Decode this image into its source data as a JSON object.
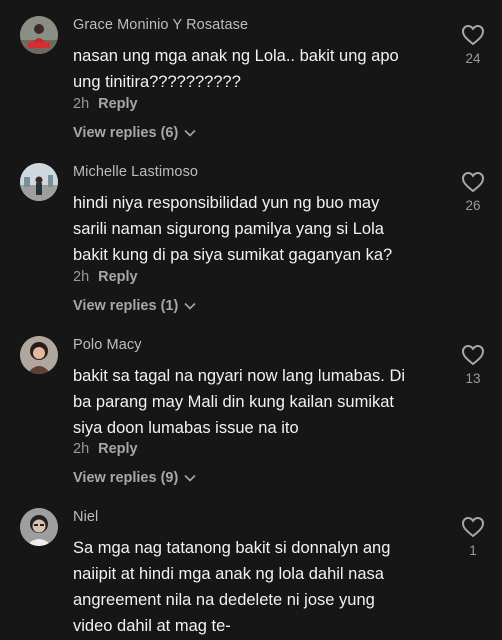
{
  "comments": [
    {
      "username": "Grace Moninio Y Rosatase",
      "text": "nasan ung mga anak ng Lola.. bakit ung apo\nung tinitira??????????",
      "time": "2h",
      "reply_label": "Reply",
      "view_replies": "View replies (6)",
      "likes": "24",
      "avatar_icon": "profile-photo-person-red"
    },
    {
      "username": "Michelle Lastimoso",
      "text": "hindi niya responsibilidad yun ng buo may\nsarili naman sigurong pamilya yang si Lola\nbakit kung di pa siya sumikat gaganyan ka?",
      "time": "2h",
      "reply_label": "Reply",
      "view_replies": "View replies (1)",
      "likes": "26",
      "avatar_icon": "profile-photo-outdoor"
    },
    {
      "username": "Polo Macy",
      "text": "bakit sa tagal na ngyari now lang lumabas. Di\nba parang may Mali din kung kailan sumikat\nsiya doon lumabas issue na ito",
      "time": "2h",
      "reply_label": "Reply",
      "view_replies": "View replies (9)",
      "likes": "13",
      "avatar_icon": "profile-photo-woman"
    },
    {
      "username": "Niel",
      "text": "Sa mga nag tatanong bakit si donnalyn ang\nnaiipit at hindi mga anak ng lola dahil nasa\nangreement nila na dedelete ni jose yung\nvideo dahil at mag te-",
      "likes": "1",
      "avatar_icon": "profile-photo-man"
    }
  ],
  "colors": {
    "background": "#161616",
    "username": "#bdbdbd",
    "text": "#f2f2f2",
    "secondary": "#9a9a9a"
  }
}
